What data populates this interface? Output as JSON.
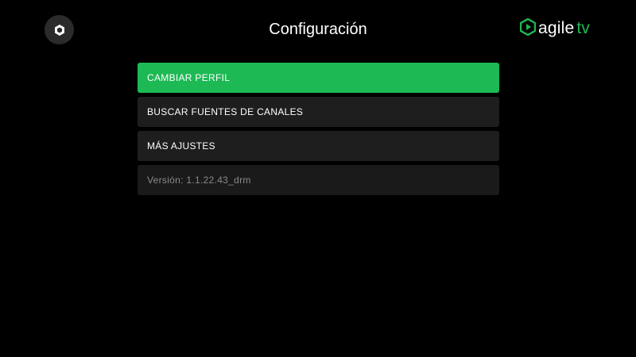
{
  "header": {
    "title": "Configuración",
    "profile_icon": "shield-icon",
    "brand": {
      "icon": "play-hexagon-icon",
      "word": "agile",
      "suffix": "tv",
      "accent_color": "#1db954"
    }
  },
  "menu": {
    "items": [
      {
        "label": "CAMBIAR PERFIL",
        "selected": true
      },
      {
        "label": "BUSCAR FUENTES DE CANALES",
        "selected": false
      },
      {
        "label": "MÁS AJUSTES",
        "selected": false
      }
    ],
    "version_text": "Versión: 1.1.22.43_drm"
  },
  "colors": {
    "background": "#000000",
    "selected": "#1db954",
    "item_background": "#1e1e1e",
    "version_text": "#8a8a8a"
  }
}
